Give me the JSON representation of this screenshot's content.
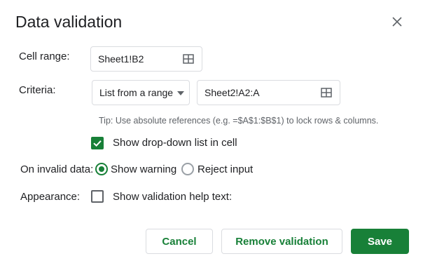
{
  "dialog": {
    "title": "Data validation",
    "close_icon": "close-icon"
  },
  "cell_range": {
    "label": "Cell range:",
    "value": "Sheet1!B2",
    "icon": "grid-icon"
  },
  "criteria": {
    "label": "Criteria:",
    "type_value": "List from a range",
    "range_value": "Sheet2!A2:A",
    "icon": "grid-icon"
  },
  "tip": "Tip: Use absolute references (e.g. =$A$1:$B$1) to lock rows & columns.",
  "show_dropdown": {
    "label": "Show drop-down list in cell",
    "checked": true
  },
  "invalid_data": {
    "label": "On invalid data:",
    "options": [
      {
        "label": "Show warning",
        "selected": true
      },
      {
        "label": "Reject input",
        "selected": false
      }
    ]
  },
  "appearance": {
    "label": "Appearance:",
    "help_text_label": "Show validation help text:",
    "checked": false
  },
  "buttons": {
    "cancel": "Cancel",
    "remove": "Remove validation",
    "save": "Save"
  },
  "colors": {
    "accent": "#188038",
    "text": "#202124",
    "muted": "#5f6368",
    "border": "#dadce0"
  }
}
